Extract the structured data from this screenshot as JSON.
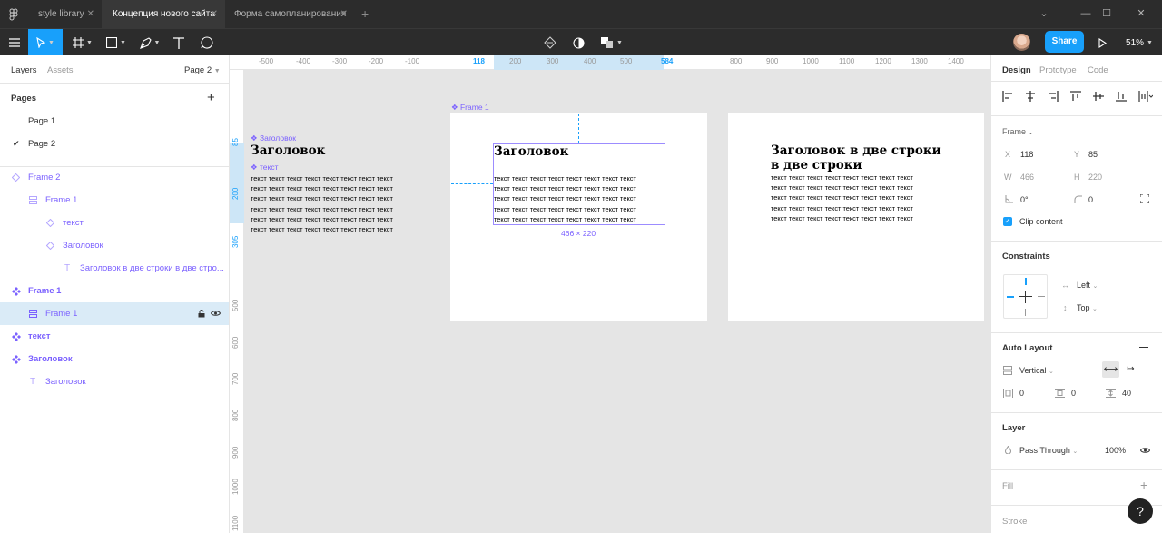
{
  "tabs": [
    {
      "label": "style library"
    },
    {
      "label": "Концепция нового сайта"
    },
    {
      "label": "Форма самопланирования"
    }
  ],
  "toolbar": {
    "share_label": "Share",
    "zoom": "51%"
  },
  "left_panel": {
    "tab_layers": "Layers",
    "tab_assets": "Assets",
    "current_page": "Page 2",
    "pages_title": "Pages",
    "pages": [
      "Page 1",
      "Page 2"
    ],
    "layers": [
      {
        "label": "Frame 2"
      },
      {
        "label": "Frame 1"
      },
      {
        "label": "текст"
      },
      {
        "label": "Заголовок"
      },
      {
        "label": "Заголовок в две строки в две стро..."
      },
      {
        "label": "Frame 1"
      },
      {
        "label": "Frame 1"
      },
      {
        "label": "текст"
      },
      {
        "label": "Заголовок"
      },
      {
        "label": "Заголовок"
      }
    ]
  },
  "canvas": {
    "ruler_top": [
      "-500",
      "-400",
      "-300",
      "-200",
      "-100",
      "118",
      "200",
      "300",
      "400",
      "500",
      "584",
      "800",
      "900",
      "1000",
      "1100",
      "1200",
      "1300",
      "1400"
    ],
    "ruler_left": [
      "85",
      "200",
      "305",
      "500",
      "600",
      "700",
      "800",
      "900",
      "1000",
      "1100"
    ],
    "frame_label": "Frame 1",
    "component_heading_label": "Заголовок",
    "component_text_label": "текст",
    "heading": "Заголовок",
    "heading_two_lines_1": "Заголовок в две строки",
    "heading_two_lines_2": "в две строки",
    "body_line": "текст текст текст текст текст текст текст текст",
    "size_label": "466 × 220"
  },
  "right_panel": {
    "tabs": [
      "Design",
      "Prototype",
      "Code"
    ],
    "frame_type": "Frame",
    "x_label": "X",
    "x": "118",
    "y_label": "Y",
    "y": "85",
    "w_label": "W",
    "w": "466",
    "h_label": "H",
    "h": "220",
    "rotation": "0°",
    "radius": "0",
    "clip_content": "Clip content",
    "constraints_title": "Constraints",
    "constraint_h": "Left",
    "constraint_v": "Top",
    "auto_layout_title": "Auto Layout",
    "direction": "Vertical",
    "padding_h": "0",
    "padding_v": "0",
    "spacing": "40",
    "layer_title": "Layer",
    "blend": "Pass Through",
    "opacity": "100%",
    "fill_title": "Fill",
    "stroke_title": "Stroke"
  },
  "help": "?",
  "colors": {
    "accent": "#18a0fb",
    "component": "#7b61ff",
    "toolbar_bg": "#2c2c2c"
  }
}
